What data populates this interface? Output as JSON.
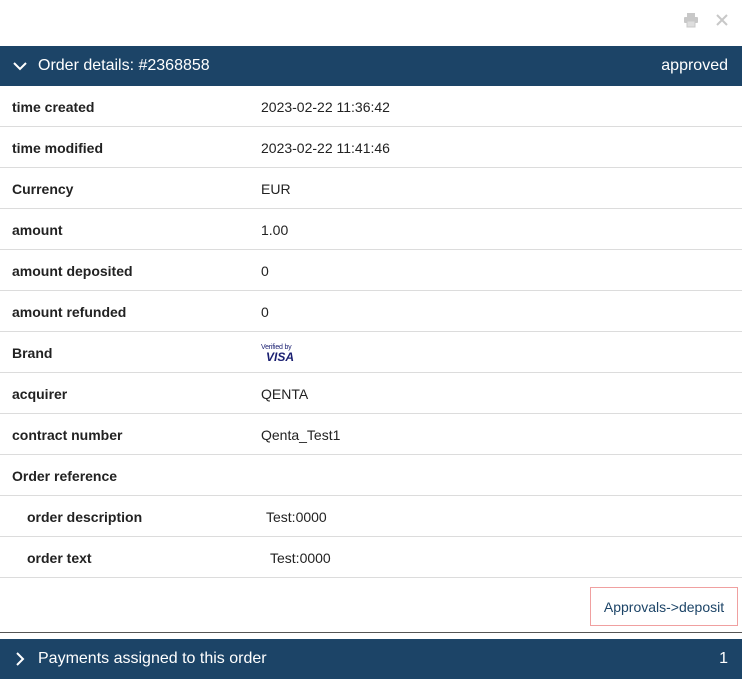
{
  "toolbar": {
    "print_icon": "printer-icon",
    "close_icon": "close-icon"
  },
  "order": {
    "title": "Order details: #2368858",
    "status": "approved",
    "rows": [
      {
        "label": "time created",
        "value": "2023-02-22 11:36:42"
      },
      {
        "label": "time modified",
        "value": "2023-02-22 11:41:46"
      },
      {
        "label": "Currency",
        "value": "EUR"
      },
      {
        "label": "amount",
        "value": "1.00"
      },
      {
        "label": "amount deposited",
        "value": "0"
      },
      {
        "label": "amount refunded",
        "value": "0"
      },
      {
        "label": "Brand",
        "value": ""
      },
      {
        "label": "acquirer",
        "value": "QENTA"
      },
      {
        "label": "contract number",
        "value": "Qenta_Test1"
      },
      {
        "label": "Order reference",
        "value": ""
      }
    ],
    "brand_logo": {
      "small": "Verified by",
      "visa": "VISA"
    },
    "reference": [
      {
        "label": "order description",
        "value": "Test:0000"
      },
      {
        "label": "order text",
        "value": "Test:0000"
      }
    ],
    "action_label": "Approvals->deposit"
  },
  "payments": {
    "title": "Payments assigned to this order",
    "count": "1"
  },
  "colors": {
    "header_bg": "#1c4467",
    "button_border": "#f0a0a0"
  }
}
